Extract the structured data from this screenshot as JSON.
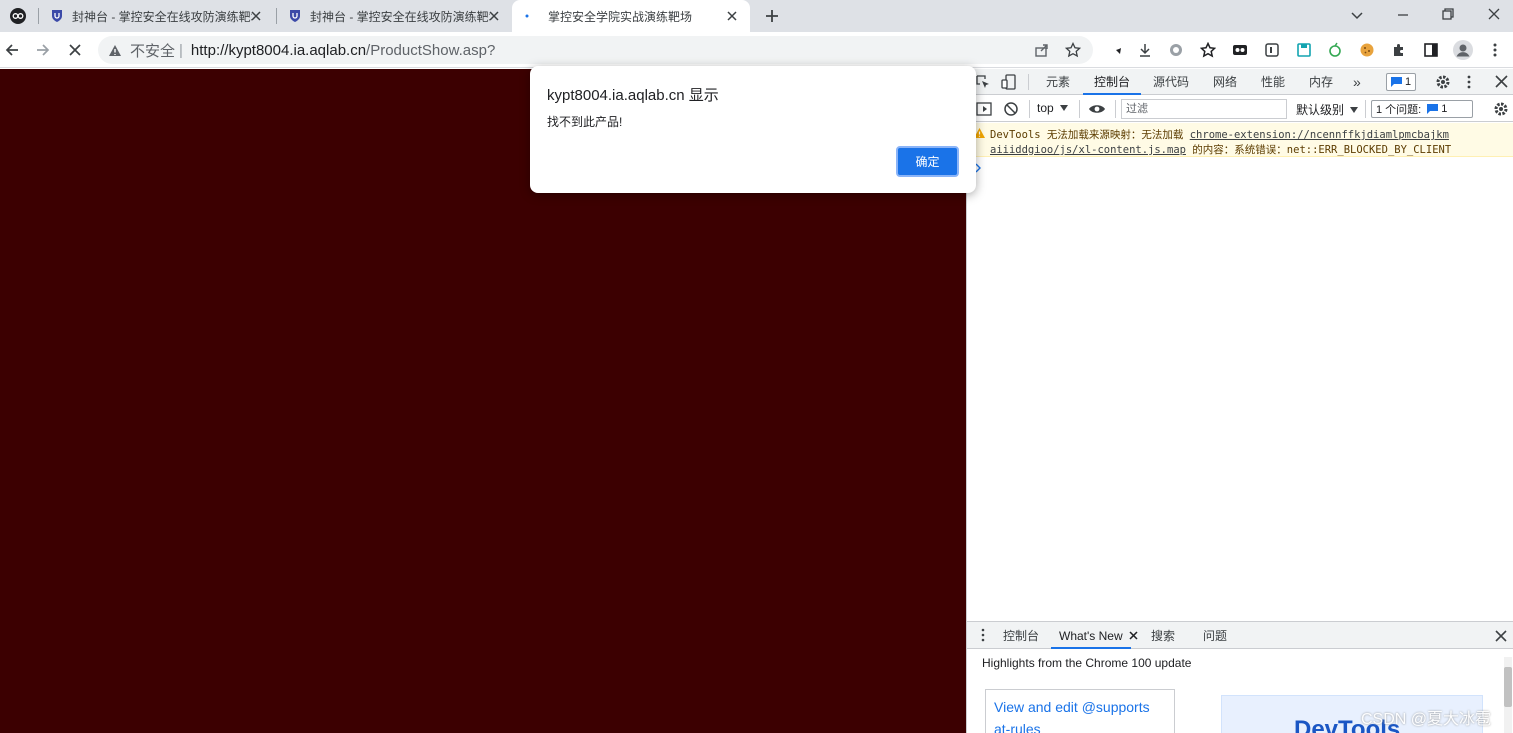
{
  "browser": {
    "tabs": [
      {
        "title": "封神台 - 掌控安全在线攻防演练靶场",
        "active": false
      },
      {
        "title": "封神台 - 掌控安全在线攻防演练靶场",
        "active": false
      },
      {
        "title": "掌控安全学院实战演练靶场",
        "active": true
      }
    ],
    "address": {
      "security_label": "不安全",
      "url_base": "http://kypt8004.ia.aqlab.cn",
      "url_path": "/ProductShow.asp?"
    }
  },
  "alert": {
    "title": "kypt8004.ia.aqlab.cn 显示",
    "message": "找不到此产品!",
    "ok_label": "确定"
  },
  "devtools": {
    "tabs": [
      "元素",
      "控制台",
      "源代码",
      "网络",
      "性能",
      "内存"
    ],
    "more_tabs": "»",
    "issues_badge": "1",
    "context": "top",
    "filter_placeholder": "过滤",
    "level": "默认级别",
    "issues_label": "1 个问题:",
    "issues_count": "1",
    "warning": {
      "prefix": "DevTools 无法加载来源映射：无法加载",
      "link1": "chrome-extension://ncennffkjdiamlpmcbajkm",
      "link2": "aiiiddgioo/js/xl-content.js.map",
      "suffix": "的内容：系统错误：net::ERR_BLOCKED_BY_CLIENT"
    },
    "drawer_tabs": [
      "控制台",
      "What's New",
      "搜索",
      "问题"
    ],
    "highlights": "Highlights from the Chrome 100 update",
    "card_text": "View and edit @supports at-rules",
    "banner_text": "DevTools"
  },
  "watermark": "CSDN @夏大冰雹",
  "colors": {
    "page_bg": "#3c0001",
    "accent": "#1a73e8"
  }
}
